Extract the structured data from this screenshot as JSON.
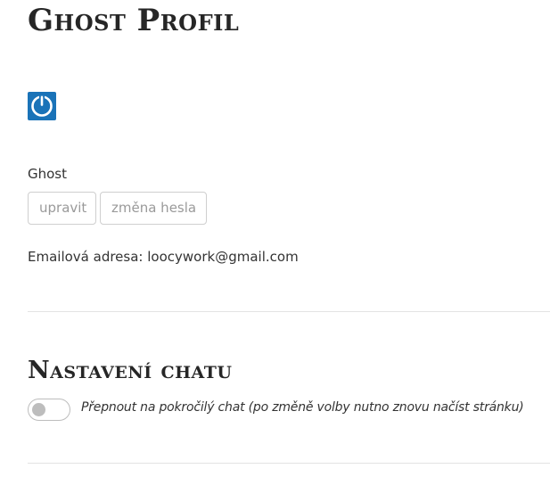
{
  "profile": {
    "title": "Ghost Profil",
    "avatar_icon": "power-icon",
    "avatar_color": "#1a73b8",
    "username": "Ghost",
    "edit_label": "upravit",
    "change_password_label": "změna hesla",
    "email_label": "Emailová adresa:",
    "email_value": "loocywork@gmail.com"
  },
  "chat_settings": {
    "title": "Nastavení chatu",
    "advanced_chat_toggle": {
      "label": "Přepnout na pokročilý chat (po změně volby nutno znovu načíst stránku)",
      "checked": false
    }
  }
}
